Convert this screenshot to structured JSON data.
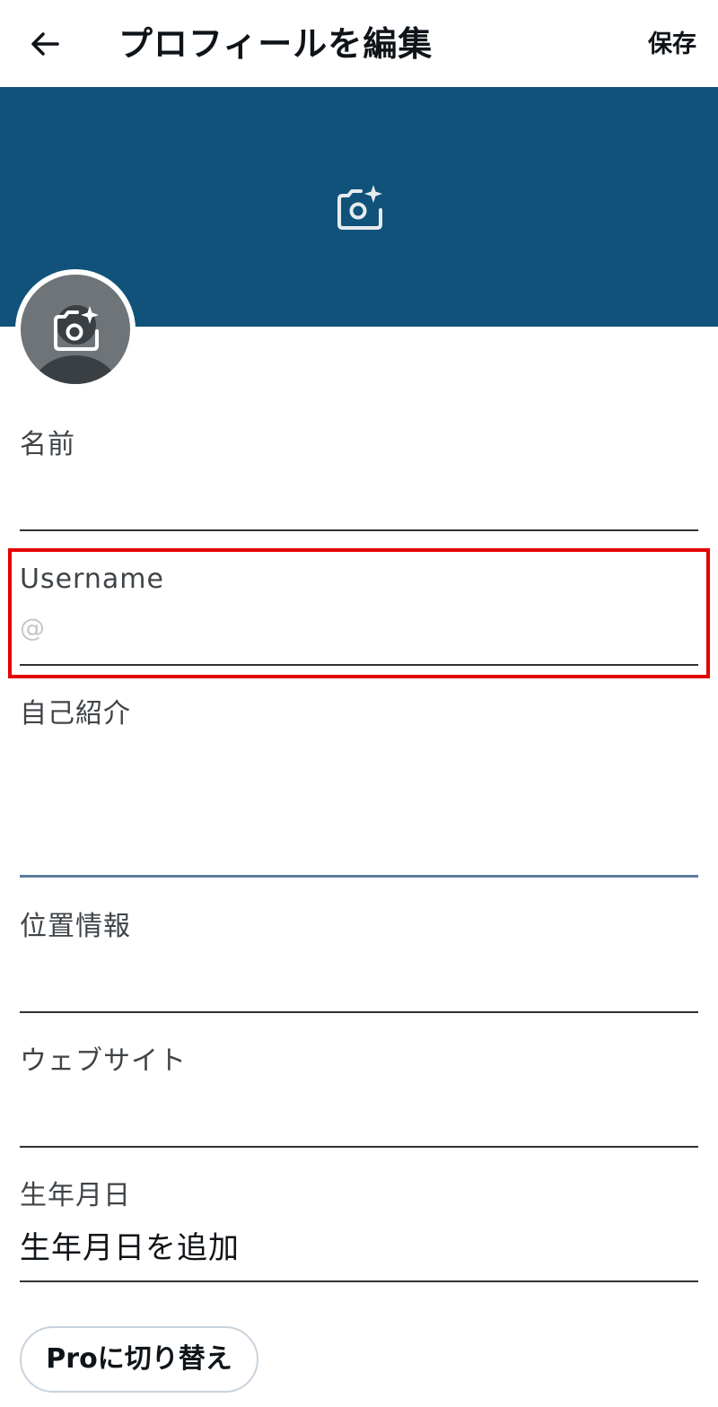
{
  "header": {
    "title": "プロフィールを編集",
    "save_label": "保存"
  },
  "colors": {
    "banner": "#10527a",
    "highlight": "#e30000"
  },
  "fields": {
    "name": {
      "label": "名前",
      "value": ""
    },
    "username": {
      "label": "Username",
      "placeholder": "@"
    },
    "bio": {
      "label": "自己紹介",
      "value": ""
    },
    "location": {
      "label": "位置情報",
      "value": ""
    },
    "website": {
      "label": "ウェブサイト",
      "value": ""
    },
    "birthday": {
      "label": "生年月日",
      "value": "生年月日を追加"
    }
  },
  "pro_button": {
    "label": "Proに切り替え"
  },
  "icons": [
    "back-arrow-icon",
    "camera-add-icon",
    "avatar-placeholder"
  ]
}
